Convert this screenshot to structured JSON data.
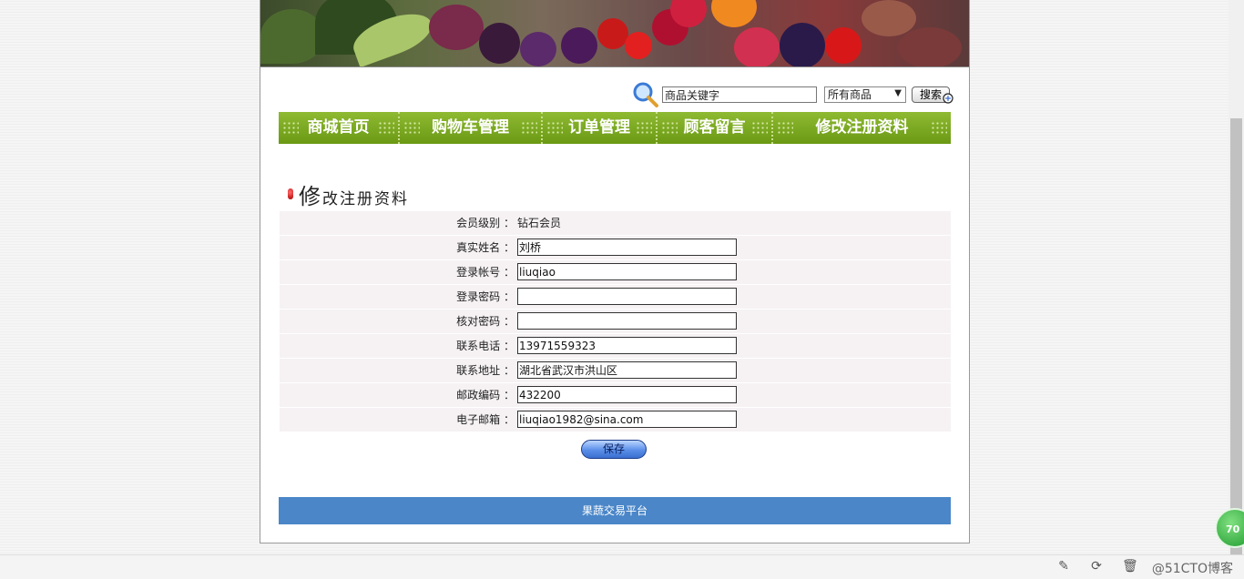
{
  "search": {
    "keyword_value": "商品关键字",
    "category_selected": "所有商品",
    "button_label": "搜索"
  },
  "nav": {
    "items": [
      {
        "label": "商城首页"
      },
      {
        "label": "购物车管理"
      },
      {
        "label": "订单管理"
      },
      {
        "label": "顾客留言"
      },
      {
        "label": "修改注册资料"
      }
    ]
  },
  "heading": {
    "first_char": "修",
    "rest": "改注册资料"
  },
  "form": {
    "rows": [
      {
        "label": "会员级别 ：",
        "value": "钻石会员"
      },
      {
        "label": "真实姓名 ：",
        "value": "刘桥"
      },
      {
        "label": "登录帐号 ：",
        "value": "liuqiao"
      },
      {
        "label": "登录密码 ：",
        "value": ""
      },
      {
        "label": "核对密码 ：",
        "value": ""
      },
      {
        "label": "联系电话 ：",
        "value": "13971559323"
      },
      {
        "label": "联系地址 ：",
        "value": "湖北省武汉市洪山区"
      },
      {
        "label": "邮政编码 ：",
        "value": "432200"
      },
      {
        "label": "电子邮箱 ：",
        "value": "liuqiao1982@sina.com"
      }
    ],
    "save_label": "保存"
  },
  "footer": {
    "text": "果蔬交易平台"
  },
  "overlay": {
    "watermark": "@51CTO博客",
    "badge": "70"
  },
  "colors": {
    "nav_green": "#6c9a17",
    "footer_blue": "#4a86c8"
  }
}
